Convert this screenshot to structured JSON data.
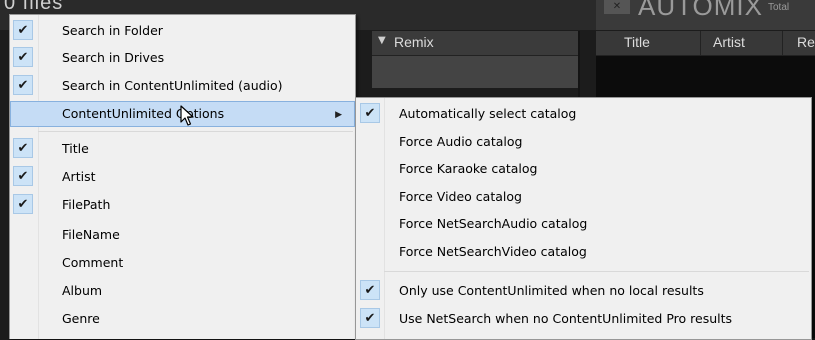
{
  "background": {
    "files_title": "0 files",
    "automix_label": "AUTOMIX",
    "total_label": "Total",
    "left_header": {
      "sort_icon": "triangle-down",
      "column": "Remix"
    },
    "right_header": {
      "columns": [
        "Title",
        "Artist",
        "Re"
      ]
    }
  },
  "menu_main": {
    "items": [
      {
        "label": "Search in Folder",
        "checked": true
      },
      {
        "label": "Search in Drives",
        "checked": true
      },
      {
        "label": "Search in ContentUnlimited (audio)",
        "checked": true
      },
      {
        "label": "ContentUnlimited Options",
        "checked": false,
        "submenu": true,
        "highlighted": true
      },
      {
        "label": "Title",
        "checked": true
      },
      {
        "label": "Artist",
        "checked": true
      },
      {
        "label": "FilePath",
        "checked": true
      },
      {
        "label": "FileName",
        "checked": false
      },
      {
        "label": "Comment",
        "checked": false
      },
      {
        "label": "Album",
        "checked": false
      },
      {
        "label": "Genre",
        "checked": false
      }
    ]
  },
  "menu_sub": {
    "items": [
      {
        "label": "Automatically select catalog",
        "checked": true
      },
      {
        "label": "Force Audio catalog",
        "checked": false
      },
      {
        "label": "Force Karaoke catalog",
        "checked": false
      },
      {
        "label": "Force Video catalog",
        "checked": false
      },
      {
        "label": "Force NetSearchAudio catalog",
        "checked": false
      },
      {
        "label": "Force NetSearchVideo catalog",
        "checked": false
      },
      {
        "label": "Only use ContentUnlimited when no local results",
        "checked": true
      },
      {
        "label": "Use NetSearch when no ContentUnlimited Pro results",
        "checked": true
      }
    ]
  },
  "icons": {
    "check": "checkmark-icon",
    "submenu": "triangle-right-icon",
    "cursor": "arrow-cursor-icon"
  },
  "colors": {
    "menu_bg": "#f0f0f0",
    "highlight": "#c5dcf5",
    "check_bg": "#cce3f7"
  }
}
